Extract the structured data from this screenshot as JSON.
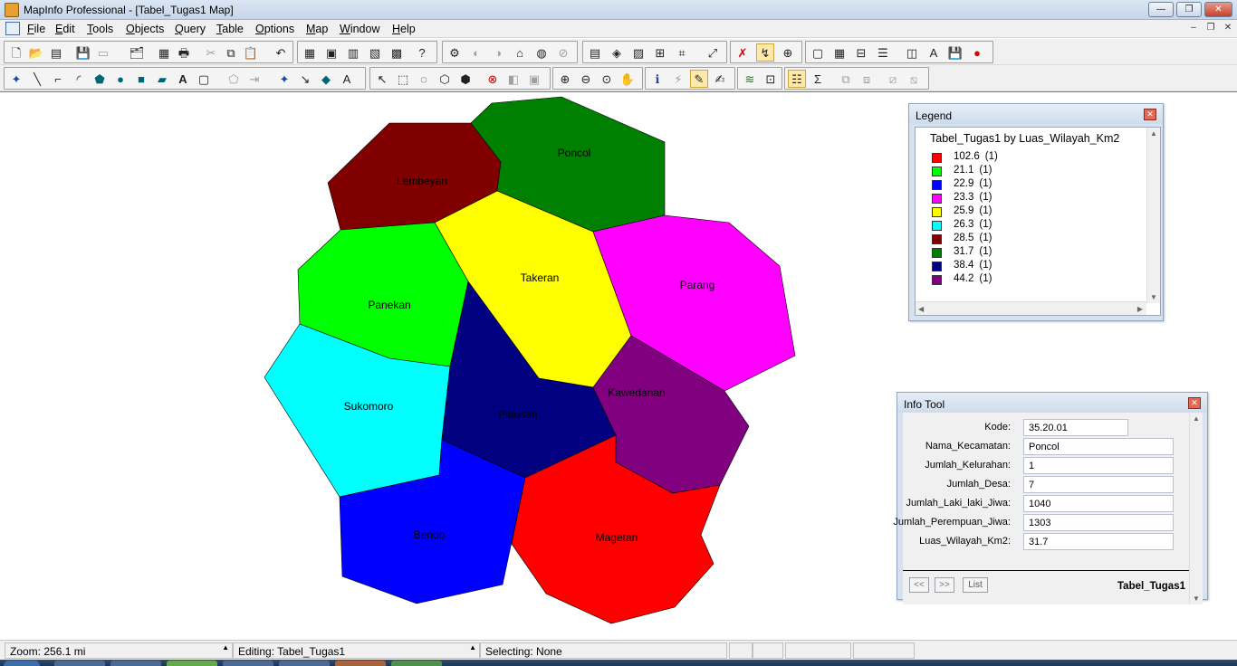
{
  "window": {
    "title": "MapInfo Professional - [Tabel_Tugas1 Map]",
    "minimize_glyph": "—",
    "restore_glyph": "❐",
    "close_glyph": "✕"
  },
  "menu": {
    "items": [
      "File",
      "Edit",
      "Tools",
      "Objects",
      "Query",
      "Table",
      "Options",
      "Map",
      "Window",
      "Help"
    ],
    "mdi_minimize": "–",
    "mdi_restore": "❐",
    "mdi_close": "✕"
  },
  "map": {
    "regions": [
      {
        "name": "Lembeyan",
        "color": "#800000"
      },
      {
        "name": "Poncol",
        "color": "#008000"
      },
      {
        "name": "Takeran",
        "color": "#ffff00"
      },
      {
        "name": "Parang",
        "color": "#ff00ff"
      },
      {
        "name": "Panekan",
        "color": "#00ff00"
      },
      {
        "name": "Sukomoro",
        "color": "#00ffff"
      },
      {
        "name": "Plaosan",
        "color": "#000080"
      },
      {
        "name": "Kawedanan",
        "color": "#800080"
      },
      {
        "name": "Bendo",
        "color": "#0000ff"
      },
      {
        "name": "Magetan",
        "color": "#ff0000"
      }
    ]
  },
  "legend": {
    "window_title": "Legend",
    "heading": "Tabel_Tugas1 by Luas_Wilayah_Km2",
    "close_glyph": "✕",
    "items": [
      {
        "value": "102.6",
        "count": "(1)",
        "color": "#ff0000"
      },
      {
        "value": "21.1",
        "count": "(1)",
        "color": "#00ff00"
      },
      {
        "value": "22.9",
        "count": "(1)",
        "color": "#0000ff"
      },
      {
        "value": "23.3",
        "count": "(1)",
        "color": "#ff00ff"
      },
      {
        "value": "25.9",
        "count": "(1)",
        "color": "#ffff00"
      },
      {
        "value": "26.3",
        "count": "(1)",
        "color": "#00ffff"
      },
      {
        "value": "28.5",
        "count": "(1)",
        "color": "#800000"
      },
      {
        "value": "31.7",
        "count": "(1)",
        "color": "#008000"
      },
      {
        "value": "38.4",
        "count": "(1)",
        "color": "#000080"
      },
      {
        "value": "44.2",
        "count": "(1)",
        "color": "#800080"
      }
    ]
  },
  "info_tool": {
    "window_title": "Info Tool",
    "close_glyph": "✕",
    "fields": [
      {
        "label": "Kode:",
        "value": "35.20.01"
      },
      {
        "label": "Nama_Kecamatan:",
        "value": "Poncol"
      },
      {
        "label": "Jumlah_Kelurahan:",
        "value": "1"
      },
      {
        "label": "Jumlah_Desa:",
        "value": "7"
      },
      {
        "label": "Jumlah_Laki_laki_Jiwa:",
        "value": "1040"
      },
      {
        "label": "Jumlah_Perempuan_Jiwa:",
        "value": "1303"
      },
      {
        "label": "Luas_Wilayah_Km2:",
        "value": "31.7"
      }
    ],
    "prev_label": "<<",
    "next_label": ">>",
    "list_label": "List",
    "table_name": "Tabel_Tugas1"
  },
  "status": {
    "zoom": "Zoom: 256.1 mi",
    "editing": "Editing: Tabel_Tugas1",
    "selecting": "Selecting: None"
  }
}
